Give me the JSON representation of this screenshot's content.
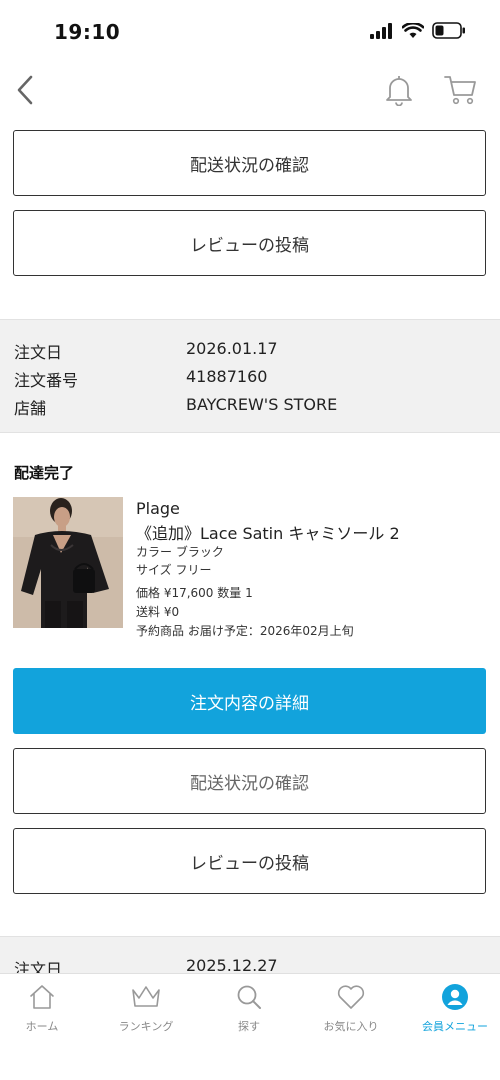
{
  "status_bar": {
    "time": "19:10"
  },
  "nav": {
    "back": "back",
    "notifications": "notifications",
    "cart": "cart"
  },
  "order1": {
    "track_button": "配送状況の確認",
    "review_button": "レビューの投稿"
  },
  "order2": {
    "info": [
      {
        "label": "注文日",
        "value": "2026.01.17"
      },
      {
        "label": "注文番号",
        "value": "41887160"
      },
      {
        "label": "店舗",
        "value": "BAYCREW'S STORE"
      }
    ],
    "status": "配達完了",
    "product": {
      "brand": "Plage",
      "name": "《追加》Lace Satin キャミソール 2",
      "color": "カラー ブラック",
      "size": "サイズ フリー",
      "price_qty": "価格 ¥17,600 数量 1",
      "shipping": "送料 ¥0",
      "reservation": "予約商品 お届け予定：2026年02月上旬"
    },
    "detail_button": "注文内容の詳細",
    "track_button": "配送状況の確認",
    "review_button": "レビューの投稿"
  },
  "order3": {
    "info": [
      {
        "label": "注文日",
        "value": "2025.12.27"
      }
    ]
  },
  "tab_bar": {
    "items": [
      {
        "label": "ホーム",
        "icon": "home-icon"
      },
      {
        "label": "ランキング",
        "icon": "crown-icon"
      },
      {
        "label": "探す",
        "icon": "search-icon"
      },
      {
        "label": "お気に入り",
        "icon": "heart-icon"
      },
      {
        "label": "会員メニュー",
        "icon": "member-icon"
      }
    ],
    "active_color": "#12a3dc"
  },
  "colors": {
    "accent": "#12a3dc",
    "info_bg": "#f1f1f1"
  }
}
